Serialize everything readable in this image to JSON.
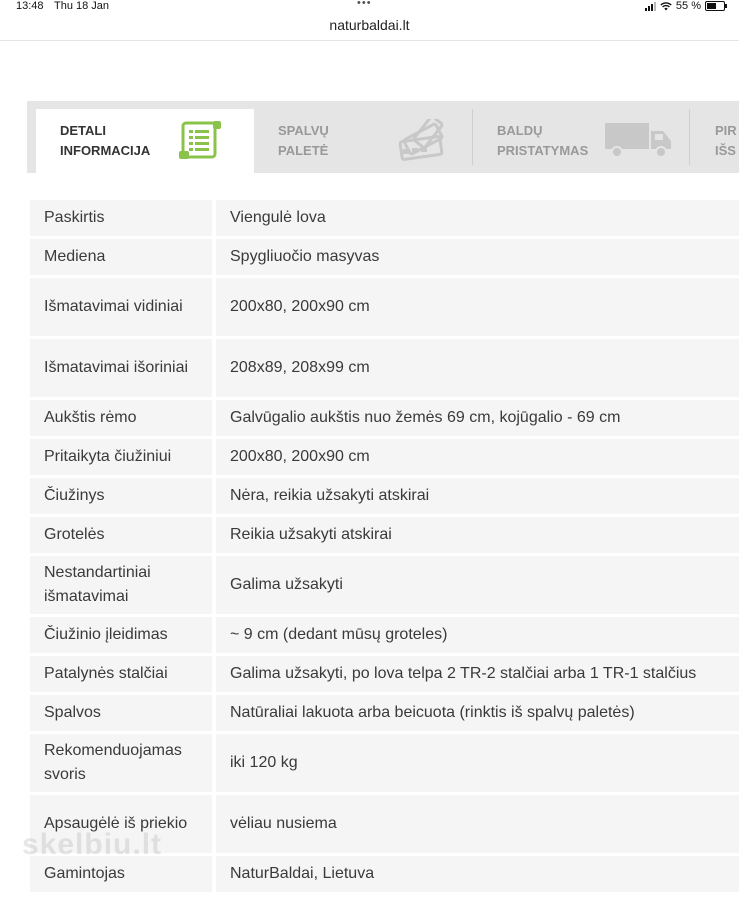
{
  "status": {
    "time": "13:48",
    "date": "Thu 18 Jan",
    "battery": "55 %"
  },
  "browser": {
    "url": "naturbaldai.lt"
  },
  "tabs": [
    {
      "label": "DETALI\nINFORMACIJA",
      "icon": "document-list-icon",
      "active": true
    },
    {
      "label": "SPALVŲ\nPALETĖ",
      "icon": "color-palette-icon",
      "active": false
    },
    {
      "label": "BALDŲ\nPRISTATYMAS",
      "icon": "delivery-truck-icon",
      "active": false
    },
    {
      "label": "PIR\nIŠS",
      "icon": "",
      "active": false
    }
  ],
  "specs": [
    {
      "key": "Paskirtis",
      "value": "Viengulė lova"
    },
    {
      "key": "Mediena",
      "value": "Spygliuočio masyvas"
    },
    {
      "key": "Išmatavimai vidiniai",
      "value": "200x80, 200x90 cm"
    },
    {
      "key": "Išmatavimai išoriniai",
      "value": "208x89, 208x99 cm"
    },
    {
      "key": "Aukštis rėmo",
      "value": "Galvūgalio aukštis nuo žemės 69 cm, kojūgalio - 69 cm"
    },
    {
      "key": "Pritaikyta čiužiniui",
      "value": "200x80, 200x90 cm"
    },
    {
      "key": "Čiužinys",
      "value": "Nėra, reikia užsakyti atskirai"
    },
    {
      "key": "Grotelės",
      "value": "Reikia užsakyti atskirai"
    },
    {
      "key": "Nestandartiniai išmatavimai",
      "value": "Galima užsakyti"
    },
    {
      "key": "Čiužinio įleidimas",
      "value": "~ 9 cm (dedant mūsų groteles)"
    },
    {
      "key": "Patalynės stalčiai",
      "value": "Galima užsakyti, po lova telpa 2 TR-2 stalčiai arba 1 TR-1 stalčius"
    },
    {
      "key": "Spalvos",
      "value": "Natūraliai lakuota arba beicuota (rinktis iš spalvų paletės)"
    },
    {
      "key": "Rekomenduojamas svoris",
      "value": "iki 120 kg"
    },
    {
      "key": "Apsaugėlė iš priekio",
      "value": "vėliau nusiema"
    },
    {
      "key": "Gamintojas",
      "value": "NaturBaldai, Lietuva"
    }
  ],
  "watermark": "skelbiu.lt",
  "colors": {
    "tab_bg": "#e5e5e5",
    "row_bg": "#f5f5f5",
    "icon_green": "#8bc34a",
    "icon_gray": "#c8c8c8"
  }
}
